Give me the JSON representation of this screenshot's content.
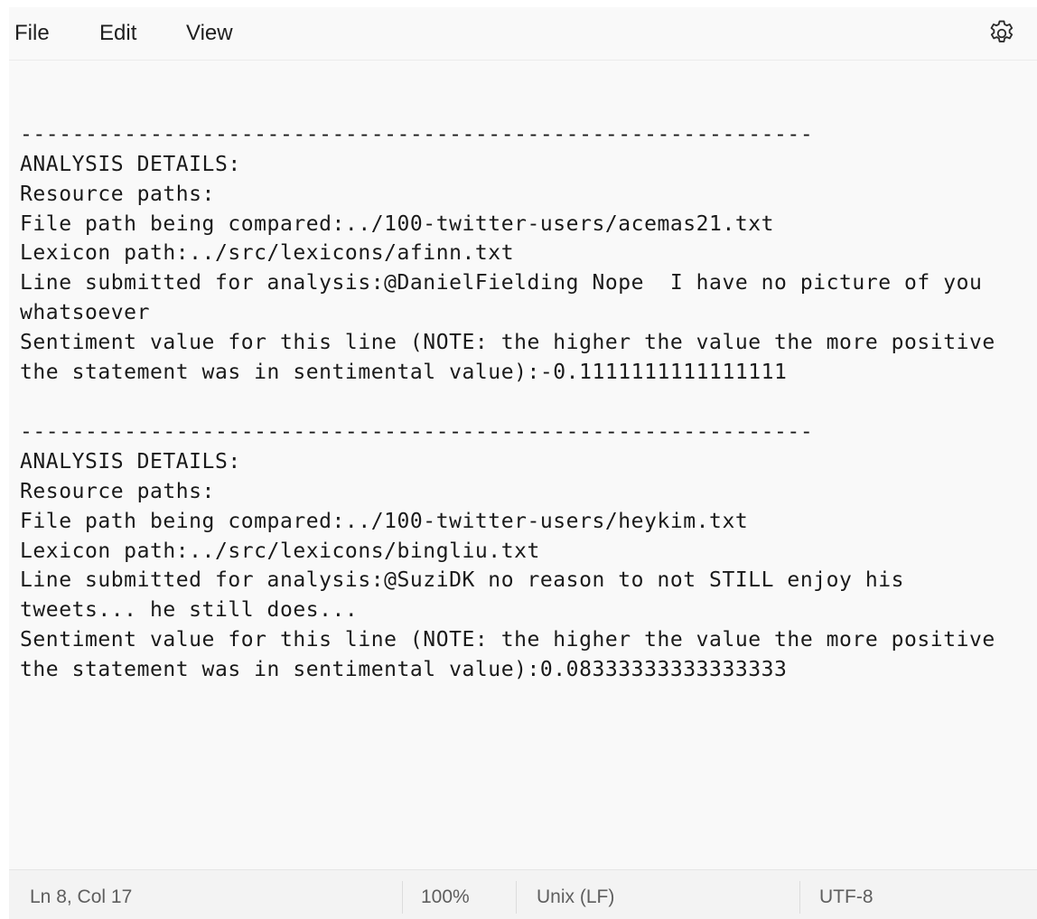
{
  "menu": {
    "file": "File",
    "edit": "Edit",
    "view": "View"
  },
  "icons": {
    "settings": "gear-icon"
  },
  "editor": {
    "lines": [
      "",
      "",
      "-------------------------------------------------------------",
      "ANALYSIS DETAILS:",
      "Resource paths:",
      "File path being compared:../100-twitter-users/acemas21.txt",
      "Lexicon path:../src/lexicons/afinn.txt",
      "Line submitted for analysis:@DanielFielding Nope  I have no picture of you",
      "whatsoever",
      "Sentiment value for this line (NOTE: the higher the value the more positive",
      "the statement was in sentimental value):-0.1111111111111111",
      "",
      "-------------------------------------------------------------",
      "ANALYSIS DETAILS:",
      "Resource paths:",
      "File path being compared:../100-twitter-users/heykim.txt",
      "Lexicon path:../src/lexicons/bingliu.txt",
      "Line submitted for analysis:@SuziDK no reason to not STILL enjoy his",
      "tweets... he still does...",
      "Sentiment value for this line (NOTE: the higher the value the more positive",
      "the statement was in sentimental value):0.08333333333333333"
    ]
  },
  "status": {
    "position": "Ln 8, Col 17",
    "zoom": "100%",
    "line_ending": "Unix (LF)",
    "encoding": "UTF-8"
  }
}
